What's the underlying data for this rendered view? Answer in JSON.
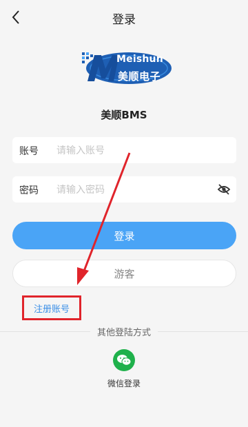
{
  "header": {
    "title": "登录",
    "back_icon": "chevron-left-icon"
  },
  "logo": {
    "text_en": "Meishun",
    "text_cn": "美顺电子"
  },
  "app_name": "美顺BMS",
  "account_field": {
    "label": "账号",
    "placeholder": "请输入账号",
    "value": ""
  },
  "password_field": {
    "label": "密码",
    "placeholder": "请输入密码",
    "value": "",
    "toggle_icon": "eye-off-icon"
  },
  "login_button": "登录",
  "guest_button": "游客",
  "register_link": "注册账号",
  "other_login": "其他登陆方式",
  "wechat": {
    "label": "微信登录",
    "icon": "wechat-icon"
  },
  "colors": {
    "primary": "#4aa4f6",
    "link": "#3a8ee6",
    "highlight": "#e0242b",
    "wechat": "#1fb14b"
  }
}
